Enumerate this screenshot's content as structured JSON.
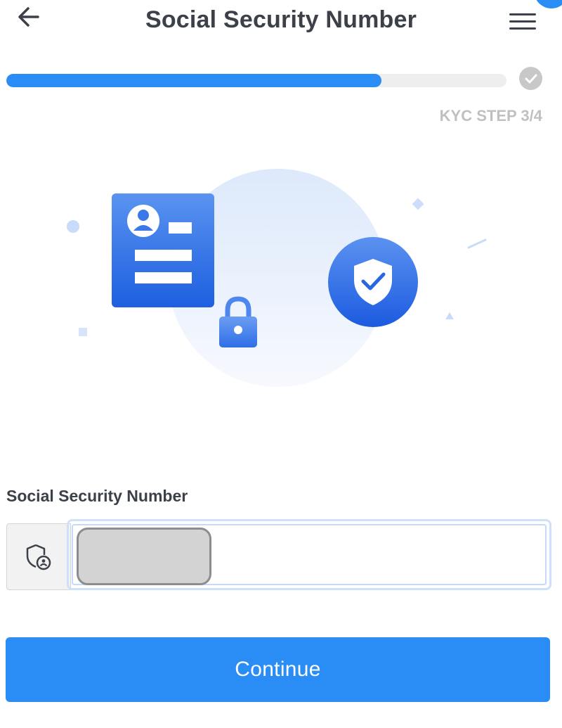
{
  "header": {
    "title": "Social Security Number",
    "back_icon": "arrow-left-icon",
    "menu_icon": "hamburger-menu-icon"
  },
  "progress": {
    "fraction": 0.75,
    "step_label": "KYC STEP 3/4",
    "status_icon": "check-circle-icon"
  },
  "illustration": {
    "icons": [
      "id-card-icon",
      "lock-icon",
      "shield-check-icon"
    ]
  },
  "form": {
    "ssn_label": "Social Security Number",
    "ssn_icon": "shield-user-icon",
    "ssn_value": "",
    "ssn_placeholder": ""
  },
  "actions": {
    "continue_label": "Continue"
  },
  "colors": {
    "accent": "#2a8cf5",
    "text": "#3c4149",
    "muted": "#c0c0c0"
  }
}
